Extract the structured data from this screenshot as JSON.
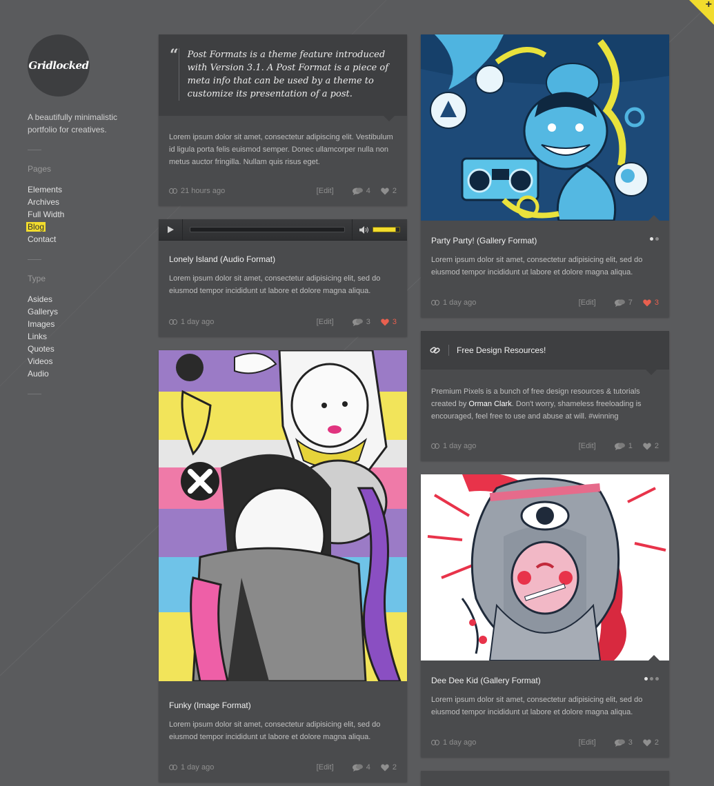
{
  "site": {
    "logo_text": "Gridlocked",
    "tagline": "A beautifully minimalistic portfolio for creatives."
  },
  "sidebar": {
    "pages_title": "Pages",
    "pages": [
      "Elements",
      "Archives",
      "Full Width",
      "Blog",
      "Contact"
    ],
    "active_page": "Blog",
    "type_title": "Type",
    "types": [
      "Asides",
      "Gallerys",
      "Images",
      "Links",
      "Quotes",
      "Videos",
      "Audio"
    ]
  },
  "posts": {
    "quote": {
      "quote": "Post Formats is a theme feature introduced with Version 3.1. A Post Format is a piece of meta info that can be used by a theme to customize its presentation of a post.",
      "text": "Lorem ipsum dolor sit amet, consectetur adipiscing elit. Vestibulum id ligula porta felis euismod semper. Donec ullamcorper nulla non metus auctor fringilla. Nullam quis risus eget.",
      "time": "21 hours ago",
      "edit": "[Edit]",
      "comments": "4",
      "likes": "2"
    },
    "audio": {
      "title": "Lonely Island (Audio Format)",
      "text": "Lorem ipsum dolor sit amet, consectetur adipisicing elit, sed do eiusmod tempor incididunt ut labore et dolore magna aliqua.",
      "time": "1 day ago",
      "edit": "[Edit]",
      "comments": "3",
      "likes": "3",
      "volume_level": 0.85
    },
    "funky": {
      "title": "Funky (Image Format)",
      "text": "Lorem ipsum dolor sit amet, consectetur adipisicing elit, sed do eiusmod tempor incididunt ut labore et dolore magna aliqua.",
      "time": "1 day ago",
      "edit": "[Edit]",
      "comments": "4",
      "likes": "2"
    },
    "party": {
      "title": "Party Party! (Gallery Format)",
      "text": "Lorem ipsum dolor sit amet, consectetur adipisicing elit, sed do eiusmod tempor incididunt ut labore et dolore magna aliqua.",
      "time": "1 day ago",
      "edit": "[Edit]",
      "comments": "7",
      "likes": "3"
    },
    "link": {
      "title": "Free Design Resources!",
      "text_before": "Premium Pixels is a bunch of free design resources & tutorials created by ",
      "author": "Orman Clark",
      "text_after": ". Don't worry, shameless freeloading is encouraged, feel free to use and abuse at will. #winning",
      "time": "1 day ago",
      "edit": "[Edit]",
      "comments": "1",
      "likes": "2"
    },
    "deedee": {
      "title": "Dee Dee Kid (Gallery Format)",
      "text": "Lorem ipsum dolor sit amet, consectetur adipisicing elit, sed do eiusmod tempor incididunt ut labore et dolore magna aliqua.",
      "time": "1 day ago",
      "edit": "[Edit]",
      "comments": "3",
      "likes": "2"
    }
  },
  "colors": {
    "accent": "#f2dc2d",
    "heart_active": "#e8604f",
    "card_bg": "#4a4b4d",
    "page_bg": "#5a5b5d"
  },
  "corner": {
    "icon": "plus-icon",
    "symbol": "+"
  }
}
